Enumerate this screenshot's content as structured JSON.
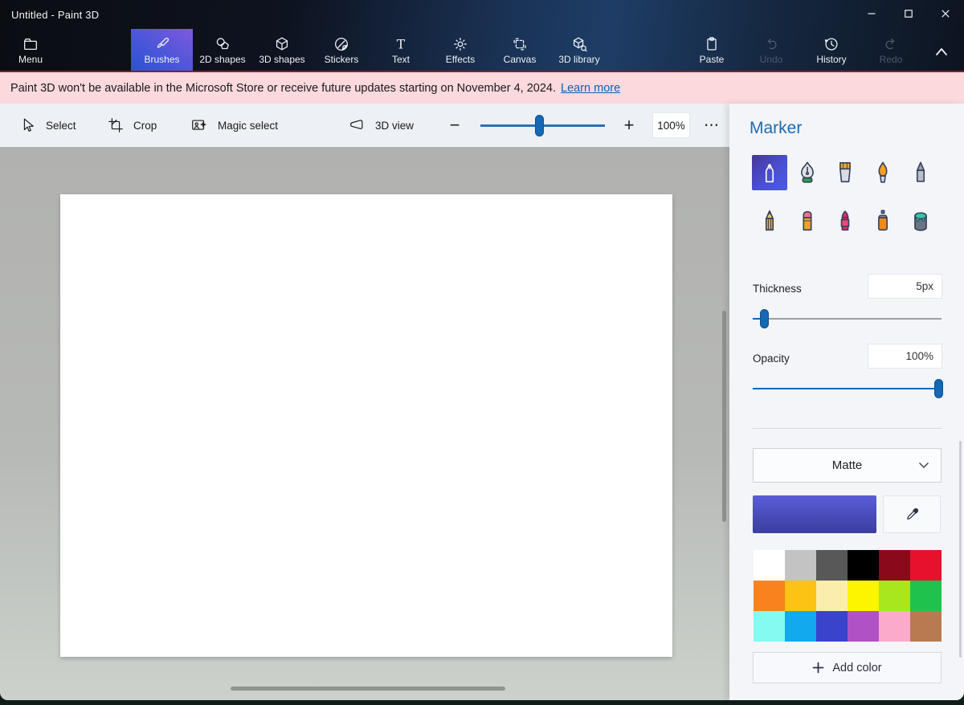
{
  "window": {
    "title": "Untitled - Paint 3D"
  },
  "ribbon": {
    "items": [
      {
        "label": "Menu"
      },
      {
        "label": "Brushes",
        "selected": true
      },
      {
        "label": "2D shapes"
      },
      {
        "label": "3D shapes"
      },
      {
        "label": "Stickers"
      },
      {
        "label": "Text"
      },
      {
        "label": "Effects"
      },
      {
        "label": "Canvas"
      },
      {
        "label": "3D library"
      },
      {
        "label": "Paste"
      },
      {
        "label": "Undo",
        "disabled": true
      },
      {
        "label": "History"
      },
      {
        "label": "Redo",
        "disabled": true
      }
    ]
  },
  "notice": {
    "message": "Paint 3D won't be available in the Microsoft Store or receive future updates starting on November 4, 2024.",
    "link_label": "Learn more"
  },
  "toolbar": {
    "select": "Select",
    "crop": "Crop",
    "magic_select": "Magic select",
    "view": "3D view",
    "zoom": {
      "value": "100%",
      "slider_percent": 47,
      "more_glyph": "⋯"
    }
  },
  "panel": {
    "title": "Marker",
    "brushes": [
      "Marker",
      "Calligraphy pen",
      "Oil brush",
      "Watercolor",
      "Pixel pen",
      "Pencil",
      "Eraser",
      "Crayon",
      "Spray can",
      "Fill"
    ],
    "selected_brush": "Marker",
    "thickness": {
      "label": "Thickness",
      "value": "5px",
      "slider_percent": 5
    },
    "opacity": {
      "label": "Opacity",
      "value": "100%",
      "slider_percent": 100
    },
    "finish": {
      "selected": "Matte"
    },
    "current_color": {
      "top": "#5a5ed6",
      "bottom": "#3b3d9e"
    },
    "palette": [
      "#ffffff",
      "#c3c3c3",
      "#585858",
      "#000000",
      "#8b0a1a",
      "#e8112d",
      "#f7821e",
      "#fcc214",
      "#fbeeac",
      "#fdf400",
      "#a8e61d",
      "#1fc24d",
      "#83fbf0",
      "#12a9ef",
      "#3a43cc",
      "#b052c5",
      "#fbaacb",
      "#b97a50"
    ],
    "add_color_label": "Add color"
  }
}
